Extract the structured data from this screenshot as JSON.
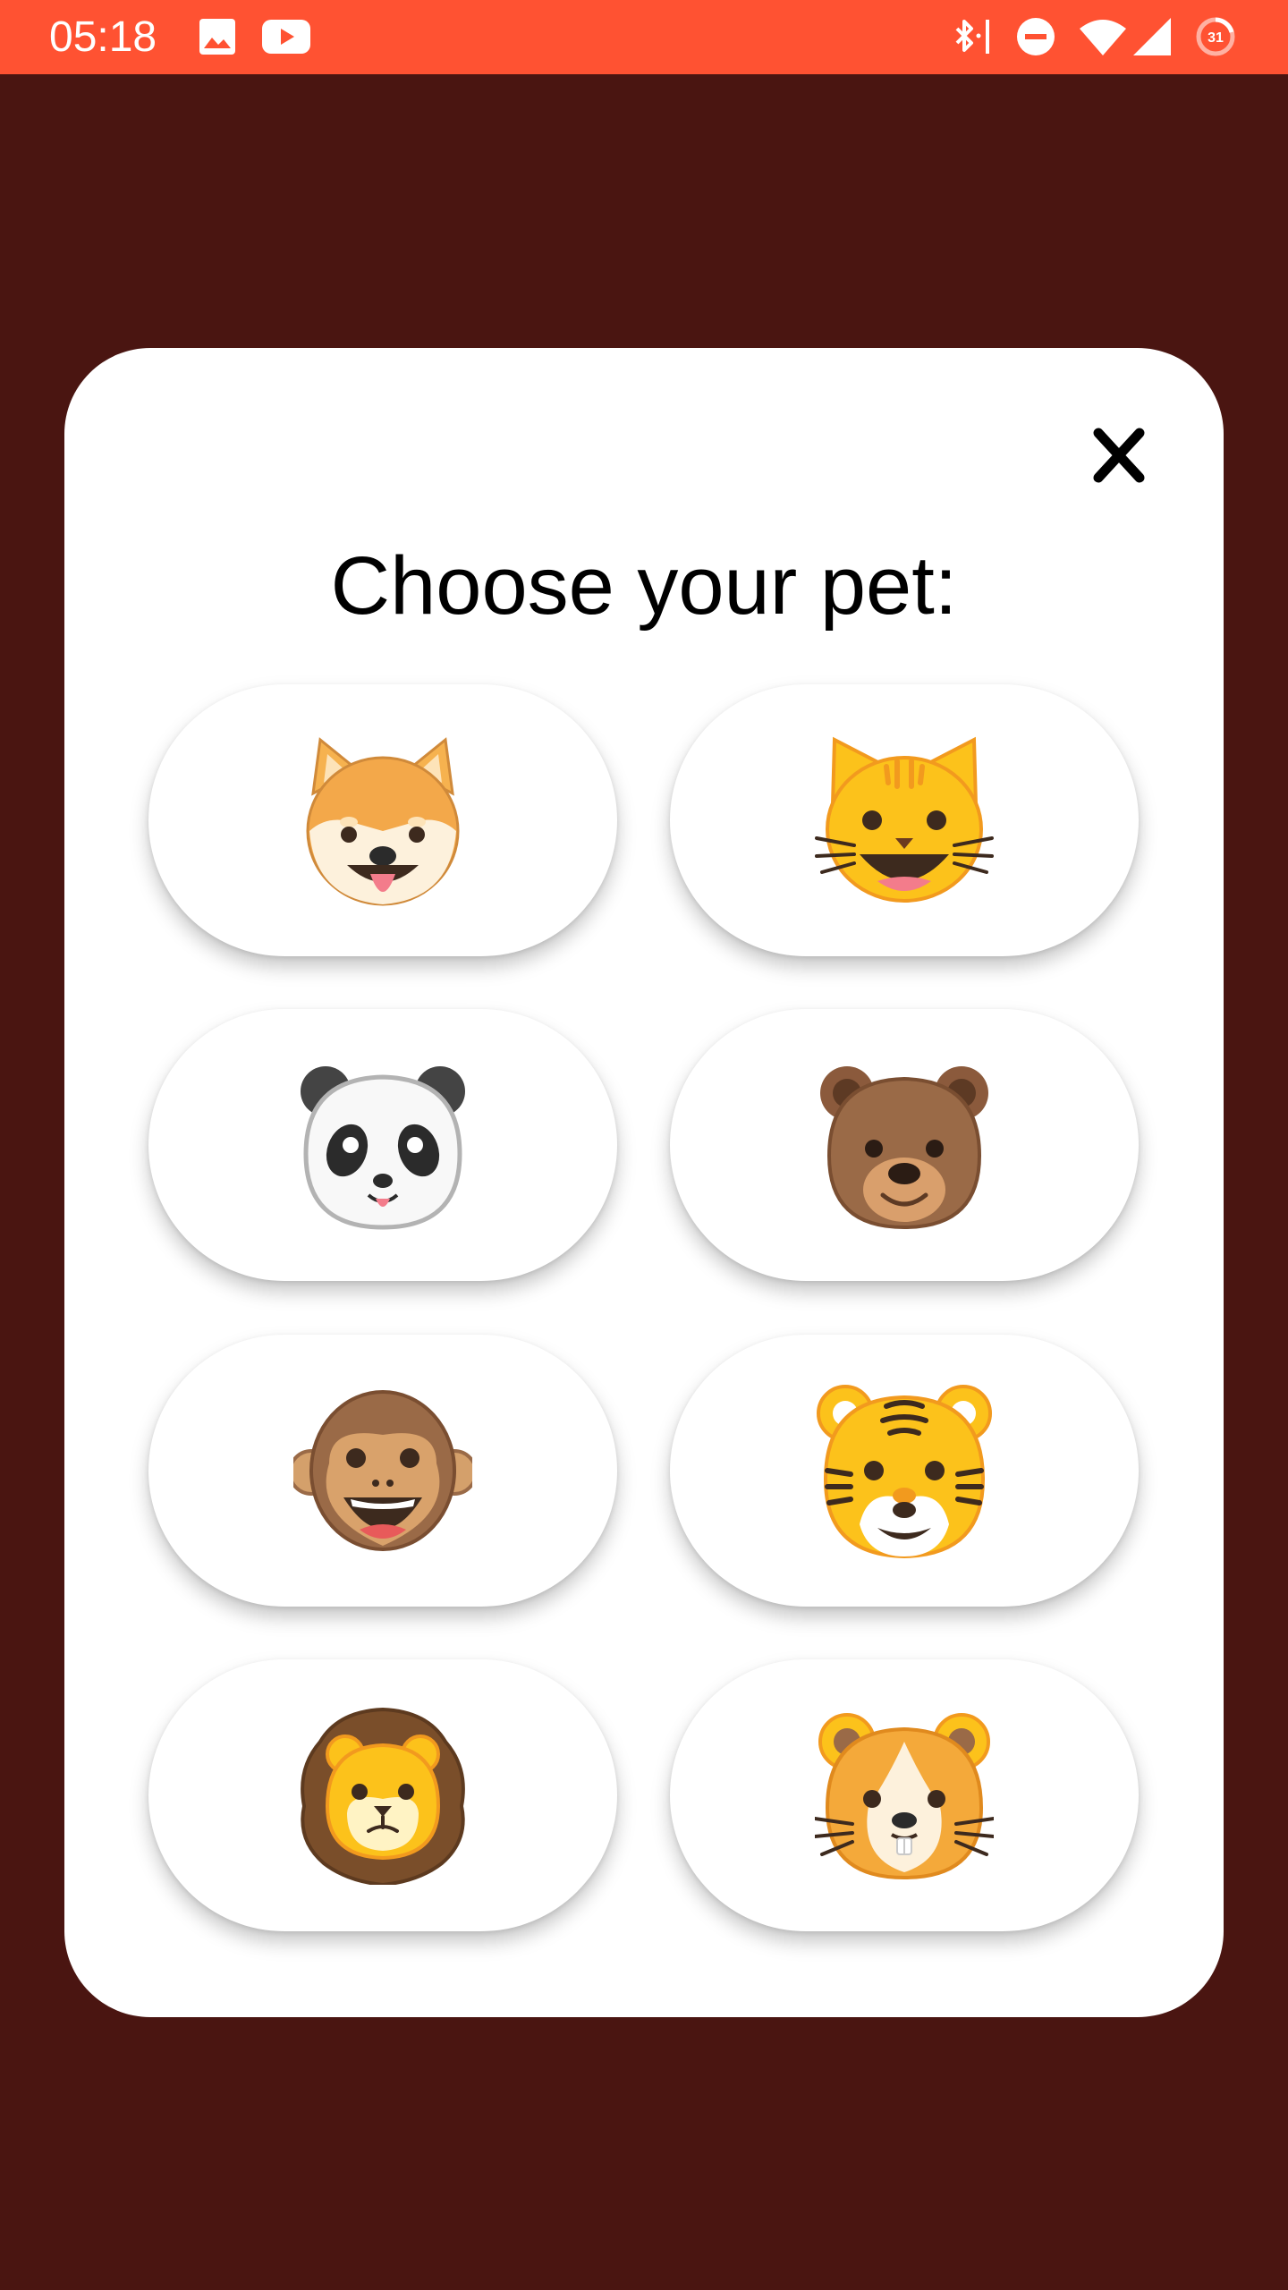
{
  "status_bar": {
    "time": "05:18",
    "battery_level": "31",
    "background_color": "#ff5232",
    "left_icons": [
      "image-icon",
      "youtube-icon"
    ],
    "right_icons": [
      "bluetooth-icon",
      "do-not-disturb-icon",
      "wifi-icon",
      "cellular-signal-icon",
      "battery-saver-icon"
    ]
  },
  "dialog": {
    "title": "Choose your pet:",
    "close_icon": "close-icon",
    "background_color": "#ffffff"
  },
  "pets": [
    {
      "id": "dog",
      "icon": "dog-face-icon"
    },
    {
      "id": "cat",
      "icon": "cat-face-icon"
    },
    {
      "id": "panda",
      "icon": "panda-face-icon"
    },
    {
      "id": "bear",
      "icon": "bear-face-icon"
    },
    {
      "id": "monkey",
      "icon": "monkey-face-icon"
    },
    {
      "id": "tiger",
      "icon": "tiger-face-icon"
    },
    {
      "id": "lion",
      "icon": "lion-face-icon"
    },
    {
      "id": "hamster",
      "icon": "hamster-face-icon"
    }
  ],
  "colors": {
    "accent": "#ff5232",
    "background": "#4a1511"
  }
}
